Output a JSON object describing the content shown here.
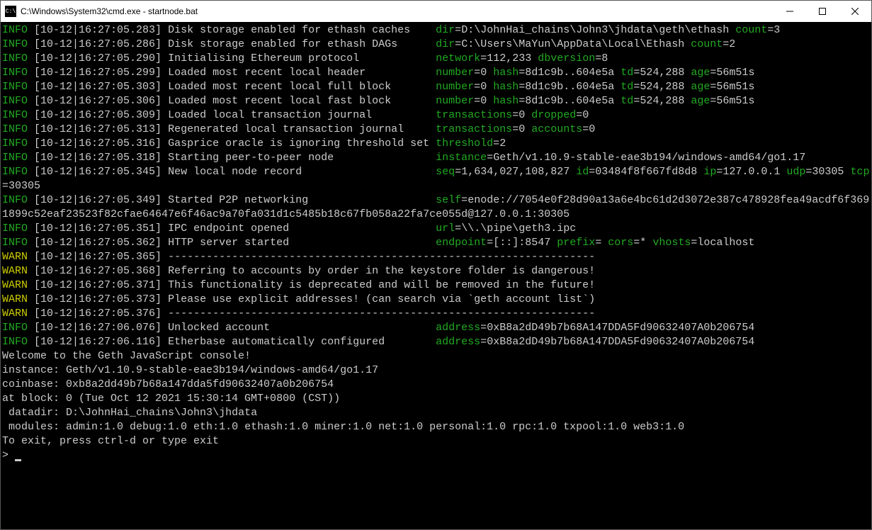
{
  "window": {
    "title": "C:\\Windows\\System32\\cmd.exe - startnode.bat",
    "icon_label": "cmd-icon"
  },
  "controls": {
    "minimize": "minimize-button",
    "maximize": "maximize-button",
    "close": "close-button"
  },
  "colors": {
    "info": "#22aa22",
    "warn": "#cccc00",
    "text": "#cccccc",
    "bg": "#000000"
  },
  "lines": [
    {
      "level": "INFO",
      "ts": "[10-12|16:27:05.283]",
      "msg": "Disk storage enabled for ethash caches  ",
      "kv": [
        [
          "dir",
          "D:\\JohnHai_chains\\John3\\jhdata\\geth\\ethash"
        ],
        [
          "count",
          "3"
        ]
      ],
      "wrap": "3"
    },
    {
      "level": "INFO",
      "ts": "[10-12|16:27:05.286]",
      "msg": "Disk storage enabled for ethash DAGs    ",
      "kv": [
        [
          "dir",
          "C:\\Users\\MaYun\\AppData\\Local\\Ethash"
        ],
        [
          "count",
          "2"
        ]
      ]
    },
    {
      "level": "INFO",
      "ts": "[10-12|16:27:05.290]",
      "msg": "Initialising Ethereum protocol          ",
      "kv": [
        [
          "network",
          "112,233"
        ],
        [
          "dbversion",
          "8"
        ]
      ]
    },
    {
      "level": "INFO",
      "ts": "[10-12|16:27:05.299]",
      "msg": "Loaded most recent local header         ",
      "kv": [
        [
          "number",
          "0"
        ],
        [
          "hash",
          "8d1c9b..604e5a"
        ],
        [
          "td",
          "524,288"
        ],
        [
          "age",
          "56m51s"
        ]
      ]
    },
    {
      "level": "INFO",
      "ts": "[10-12|16:27:05.303]",
      "msg": "Loaded most recent local full block     ",
      "kv": [
        [
          "number",
          "0"
        ],
        [
          "hash",
          "8d1c9b..604e5a"
        ],
        [
          "td",
          "524,288"
        ],
        [
          "age",
          "56m51s"
        ]
      ]
    },
    {
      "level": "INFO",
      "ts": "[10-12|16:27:05.306]",
      "msg": "Loaded most recent local fast block     ",
      "kv": [
        [
          "number",
          "0"
        ],
        [
          "hash",
          "8d1c9b..604e5a"
        ],
        [
          "td",
          "524,288"
        ],
        [
          "age",
          "56m51s"
        ]
      ]
    },
    {
      "level": "INFO",
      "ts": "[10-12|16:27:05.309]",
      "msg": "Loaded local transaction journal        ",
      "kv": [
        [
          "transactions",
          "0"
        ],
        [
          "dropped",
          "0"
        ]
      ]
    },
    {
      "level": "INFO",
      "ts": "[10-12|16:27:05.313]",
      "msg": "Regenerated local transaction journal   ",
      "kv": [
        [
          "transactions",
          "0"
        ],
        [
          "accounts",
          "0"
        ]
      ]
    },
    {
      "level": "INFO",
      "ts": "[10-12|16:27:05.316]",
      "msg": "Gasprice oracle is ignoring threshold set",
      "kv": [
        [
          "threshold",
          "2"
        ]
      ],
      "nopad": true
    },
    {
      "level": "INFO",
      "ts": "[10-12|16:27:05.318]",
      "msg": "Starting peer-to-peer node              ",
      "kv": [
        [
          "instance",
          "Geth/v1.10.9-stable-eae3b194/windows-amd64/go1.17"
        ]
      ],
      "wrap": "o1.17"
    },
    {
      "level": "INFO",
      "ts": "[10-12|16:27:05.345]",
      "msg": "New local node record                   ",
      "kv": [
        [
          "seq",
          "1,634,027,108,827"
        ],
        [
          "id",
          "03484f8f667fd8d8"
        ],
        [
          "ip",
          "127.0.0.1"
        ],
        [
          "udp",
          "30305"
        ],
        [
          "tcp",
          "30305"
        ]
      ],
      "wrap": "1 "
    },
    {
      "level": "INFO",
      "ts": "[10-12|16:27:05.349]",
      "msg": "Started P2P networking                  ",
      "kv": [
        [
          "self",
          "enode://7054e0f28d90a13a6e4bc61d2d3072e387c478928fea49acdf6f3691899c52eaf23523f82cfae64647e6f46ac9a70fa031d1c5485b18c67fb058a22fa7ce055d@127.0.0.1:30305"
        ]
      ],
      "wrap": "8fea49acdf6f3691899c52eaf23523f82cfae64647e6f46ac9a70fa031d1c5485b18c67fb058a22fa7ce055d@127.0.0.1:30305"
    },
    {
      "level": "INFO",
      "ts": "[10-12|16:27:05.351]",
      "msg": "IPC endpoint opened                     ",
      "kv": [
        [
          "url",
          "\\\\.\\pipe\\geth3.ipc"
        ]
      ]
    },
    {
      "level": "INFO",
      "ts": "[10-12|16:27:05.362]",
      "msg": "HTTP server started                     ",
      "kv": [
        [
          "endpoint",
          "[::]:8547"
        ],
        [
          "prefix",
          ""
        ],
        [
          "cors",
          "*"
        ],
        [
          "vhosts",
          "localhost"
        ]
      ]
    },
    {
      "level": "WARN",
      "ts": "[10-12|16:27:05.365]",
      "msg": "-------------------------------------------------------------------"
    },
    {
      "level": "WARN",
      "ts": "[10-12|16:27:05.368]",
      "msg": "Referring to accounts by order in the keystore folder is dangerous!"
    },
    {
      "level": "WARN",
      "ts": "[10-12|16:27:05.371]",
      "msg": "This functionality is deprecated and will be removed in the future!"
    },
    {
      "level": "WARN",
      "ts": "[10-12|16:27:05.373]",
      "msg": "Please use explicit addresses! (can search via `geth account list`)"
    },
    {
      "level": "WARN",
      "ts": "[10-12|16:27:05.376]",
      "msg": "-------------------------------------------------------------------"
    },
    {
      "level": "INFO",
      "ts": "[10-12|16:27:06.076]",
      "msg": "Unlocked account                        ",
      "kv": [
        [
          "address",
          "0xB8a2dD49b7b68A147DDA5Fd90632407A0b206754"
        ]
      ]
    },
    {
      "level": "INFO",
      "ts": "[10-12|16:27:06.116]",
      "msg": "Etherbase automatically configured      ",
      "kv": [
        [
          "address",
          "0xB8a2dD49b7b68A147DDA5Fd90632407A0b206754"
        ]
      ]
    }
  ],
  "console": {
    "welcome": "Welcome to the Geth JavaScript console!",
    "blank": "",
    "instance": "instance: Geth/v1.10.9-stable-eae3b194/windows-amd64/go1.17",
    "coinbase": "coinbase: 0xb8a2dd49b7b68a147dda5fd90632407a0b206754",
    "atblock": "at block: 0 (Tue Oct 12 2021 15:30:14 GMT+0800 (CST))",
    "datadir": " datadir: D:\\JohnHai_chains\\John3\\jhdata",
    "modules": " modules: admin:1.0 debug:1.0 eth:1.0 ethash:1.0 miner:1.0 net:1.0 personal:1.0 rpc:1.0 txpool:1.0 web3:1.0",
    "exitmsg": "To exit, press ctrl-d or type exit",
    "prompt": "> "
  }
}
